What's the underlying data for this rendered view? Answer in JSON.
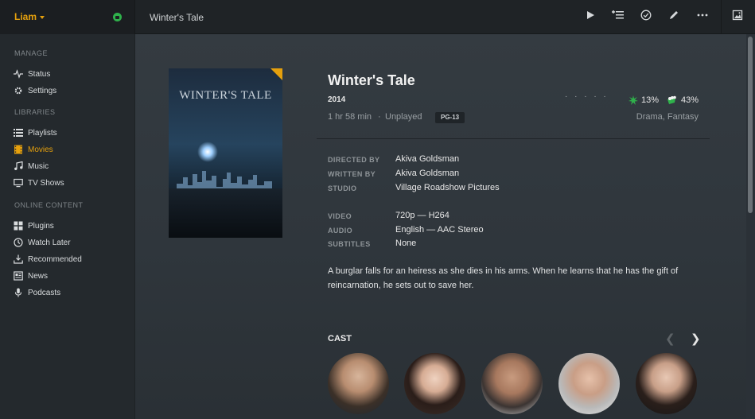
{
  "user": {
    "name": "Liam"
  },
  "header": {
    "title": "Winter's Tale"
  },
  "toolbar": {
    "icons": [
      "play-icon",
      "add-to-queue-icon",
      "mark-watched-icon",
      "edit-icon",
      "more-icon",
      "artwork-icon"
    ]
  },
  "sidebar": {
    "sections": [
      {
        "title": "MANAGE",
        "items": [
          "Status",
          "Settings"
        ]
      },
      {
        "title": "LIBRARIES",
        "items": [
          "Playlists",
          "Movies",
          "Music",
          "TV Shows"
        ]
      },
      {
        "title": "ONLINE CONTENT",
        "items": [
          "Plugins",
          "Watch Later",
          "Recommended",
          "News",
          "Podcasts"
        ]
      }
    ],
    "active_item": "Movies"
  },
  "poster": {
    "title": "WINTER'S TALE"
  },
  "movie": {
    "title": "Winter's Tale",
    "year": "2014",
    "duration": "1 hr 58 min",
    "separator": "·",
    "status": "Unplayed",
    "content_rating": "PG-13",
    "rating_dots": "· · · · ·",
    "critic_score": "13%",
    "audience_score": "43%",
    "genres": "Drama, Fantasy"
  },
  "details": {
    "directed_by_label": "DIRECTED BY",
    "directed_by": "Akiva Goldsman",
    "written_by_label": "WRITTEN BY",
    "written_by": "Akiva Goldsman",
    "studio_label": "STUDIO",
    "studio": "Village Roadshow Pictures",
    "video_label": "VIDEO",
    "video": "720p — H264",
    "audio_label": "AUDIO",
    "audio": "English — AAC Stereo",
    "subtitles_label": "SUBTITLES",
    "subtitles": "None"
  },
  "summary": "A burglar falls for an heiress as she dies in his arms. When he learns that he has the gift of reincarnation, he sets out to save her.",
  "cast": {
    "title": "CAST",
    "count": 5
  },
  "colors": {
    "accent": "#e5a00d",
    "critic_green": "#2fb14b"
  }
}
